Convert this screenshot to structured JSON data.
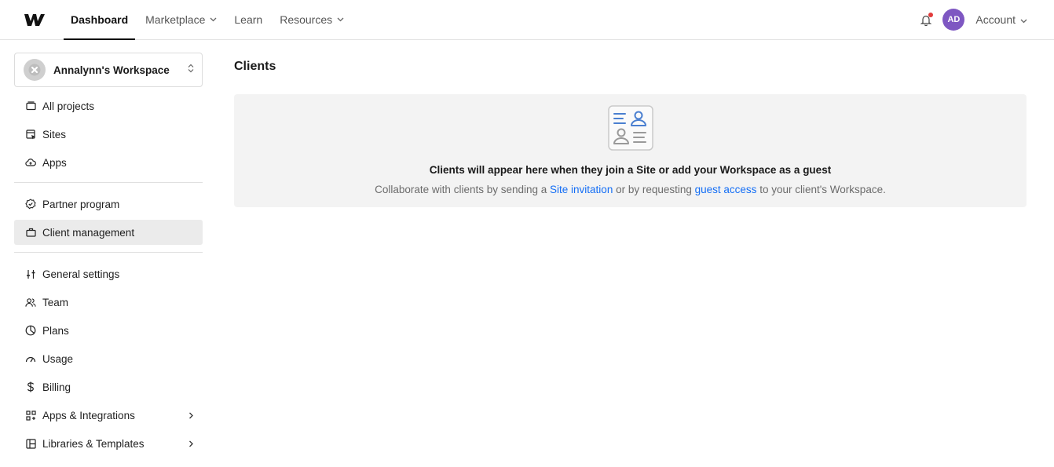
{
  "topbar": {
    "nav": [
      {
        "label": "Dashboard",
        "active": true
      },
      {
        "label": "Marketplace",
        "has_dropdown": true
      },
      {
        "label": "Learn"
      },
      {
        "label": "Resources",
        "has_dropdown": true
      }
    ],
    "avatar_initials": "AD",
    "account_label": "Account",
    "notification_dot_color": "#e23b3b",
    "avatar_color": "#7e57c2"
  },
  "sidebar": {
    "workspace_name": "Annalynn's Workspace",
    "group1": [
      {
        "label": "All projects",
        "icon": "folder-icon"
      },
      {
        "label": "Sites",
        "icon": "sites-icon"
      },
      {
        "label": "Apps",
        "icon": "cloud-icon"
      }
    ],
    "group2": [
      {
        "label": "Partner program",
        "icon": "badge-icon"
      },
      {
        "label": "Client management",
        "icon": "briefcase-icon",
        "active": true
      }
    ],
    "group3": [
      {
        "label": "General settings",
        "icon": "sliders-icon"
      },
      {
        "label": "Team",
        "icon": "team-icon"
      },
      {
        "label": "Plans",
        "icon": "plans-icon"
      },
      {
        "label": "Usage",
        "icon": "gauge-icon"
      },
      {
        "label": "Billing",
        "icon": "dollar-icon"
      },
      {
        "label": "Apps & Integrations",
        "icon": "integrations-icon",
        "has_arrow": true
      },
      {
        "label": "Libraries & Templates",
        "icon": "library-icon",
        "has_arrow": true
      }
    ]
  },
  "main": {
    "title": "Clients",
    "empty_state": {
      "heading": "Clients will appear here when they join a Site or add your Workspace as a guest",
      "text_1": "Collaborate with clients by sending a ",
      "link_1": "Site invitation",
      "text_2": " or by requesting ",
      "link_2": "guest access",
      "text_3": " to your client's Workspace.",
      "link_color": "#146ef5"
    }
  }
}
